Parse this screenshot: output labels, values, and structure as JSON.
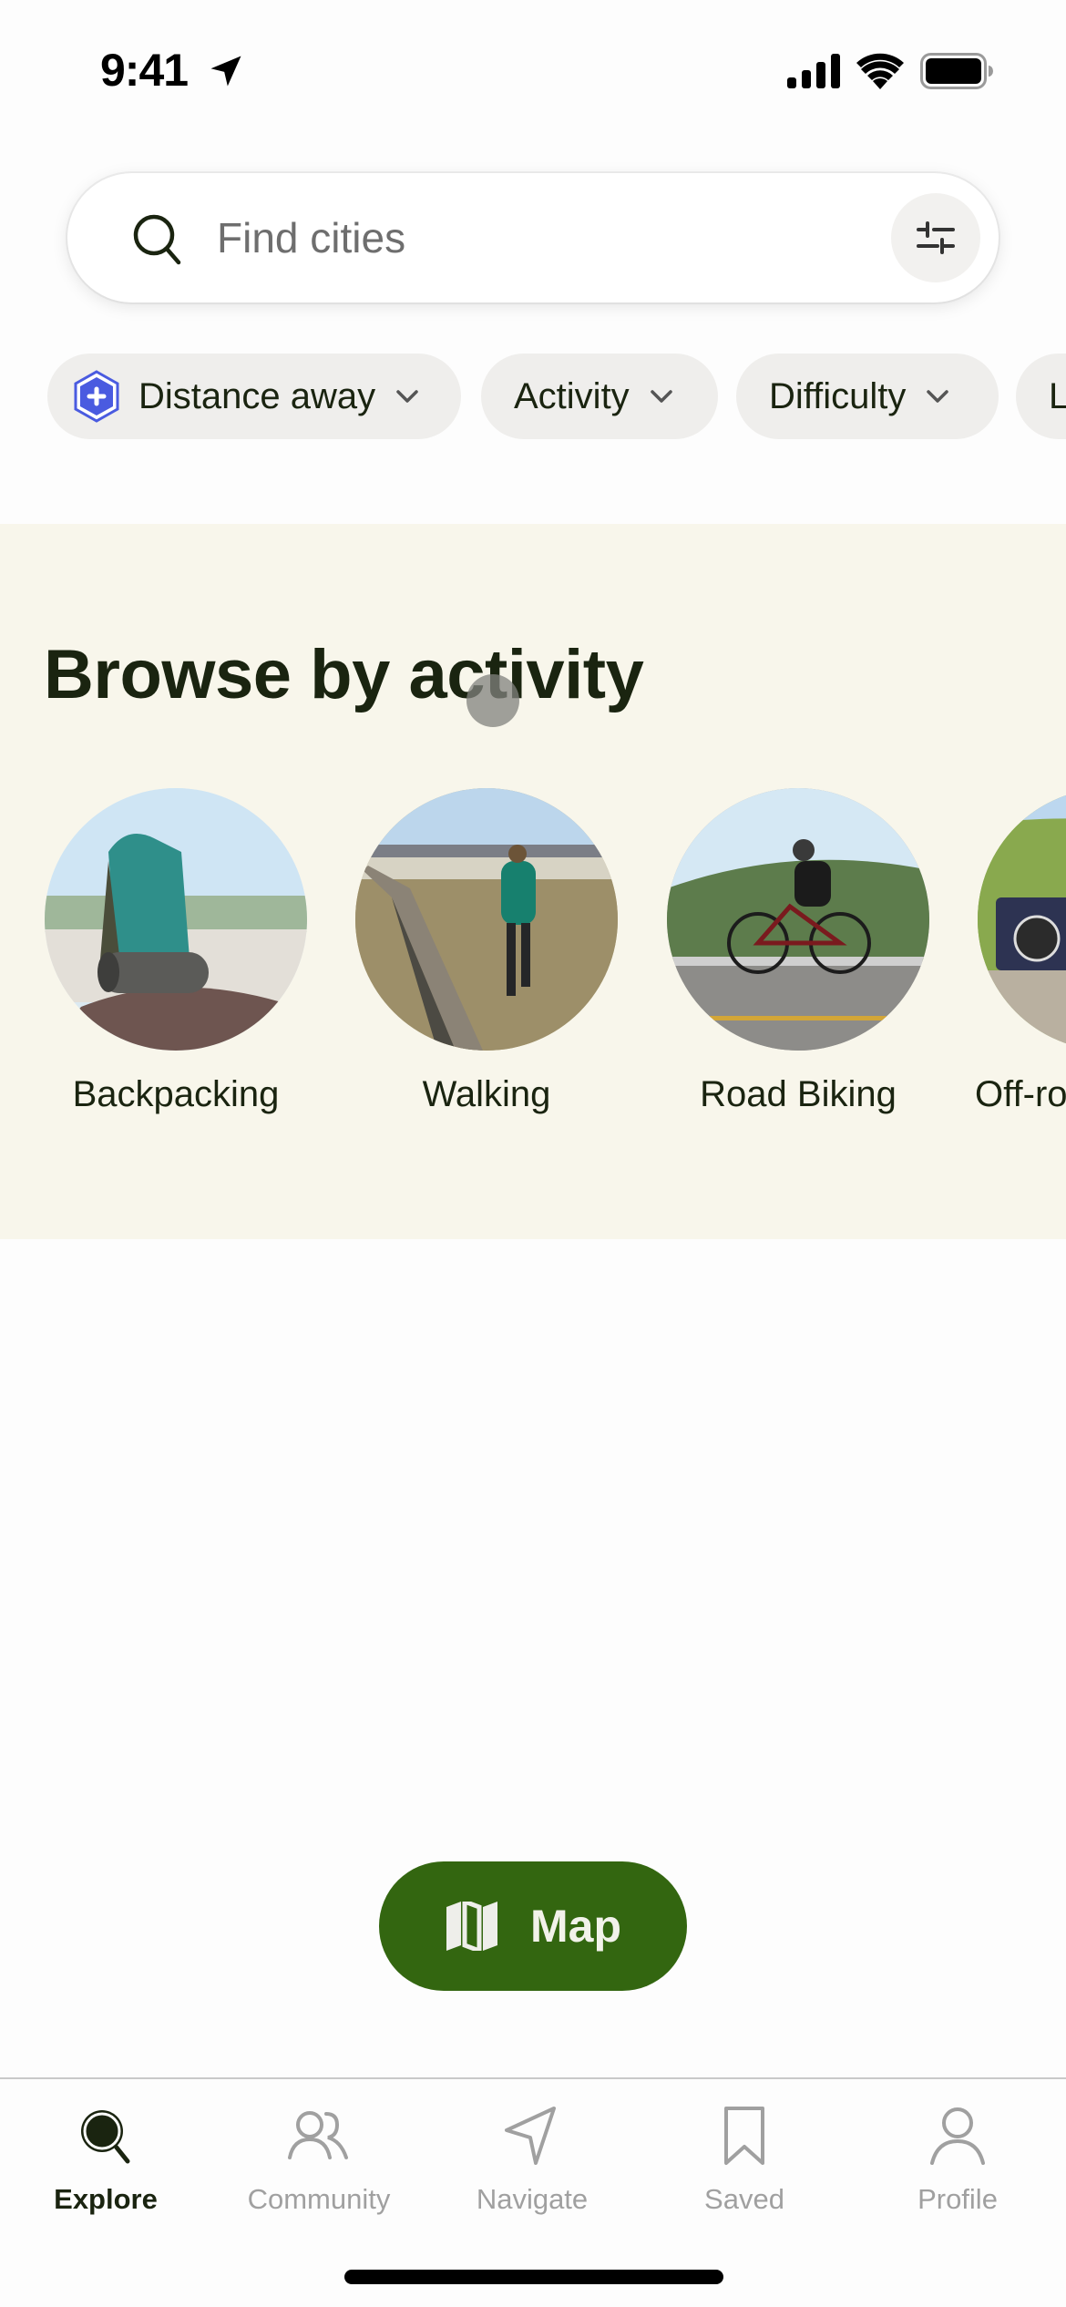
{
  "status_bar": {
    "time": "9:41",
    "icons": [
      "location-arrow-icon",
      "cellular-signal-icon",
      "wifi-icon",
      "battery-icon"
    ]
  },
  "search": {
    "placeholder": "Find cities",
    "value": "",
    "search_icon": "search-icon",
    "filter_icon": "sliders-icon"
  },
  "chips": [
    {
      "label": "Distance away",
      "icon": "plus-hexagon-badge-icon",
      "badge_color": "#4a5be0"
    },
    {
      "label": "Activity"
    },
    {
      "label": "Difficulty"
    },
    {
      "label": "L"
    }
  ],
  "browse": {
    "title": "Browse by activity",
    "activities": [
      {
        "label": "Backpacking",
        "image": "backpack-on-rock-by-lake"
      },
      {
        "label": "Walking",
        "image": "person-walking-on-boardwalk"
      },
      {
        "label": "Road Biking",
        "image": "cyclist-on-road"
      },
      {
        "label": "Off-ro",
        "image": "jeep-on-dirt-trail"
      }
    ]
  },
  "map_button": {
    "label": "Map",
    "icon": "folded-map-icon"
  },
  "tabbar": {
    "items": [
      {
        "label": "Explore",
        "icon": "explore-search-icon",
        "active": true
      },
      {
        "label": "Community",
        "icon": "people-icon",
        "active": false
      },
      {
        "label": "Navigate",
        "icon": "navigation-arrow-icon",
        "active": false
      },
      {
        "label": "Saved",
        "icon": "bookmark-icon",
        "active": false
      },
      {
        "label": "Profile",
        "icon": "person-icon",
        "active": false
      }
    ]
  },
  "colors": {
    "brand_green": "#336610",
    "text_dark": "#1a2410",
    "section_bg": "#f8f6eb",
    "chip_bg": "#efeeec",
    "inactive_tab": "#a0a0a0"
  }
}
